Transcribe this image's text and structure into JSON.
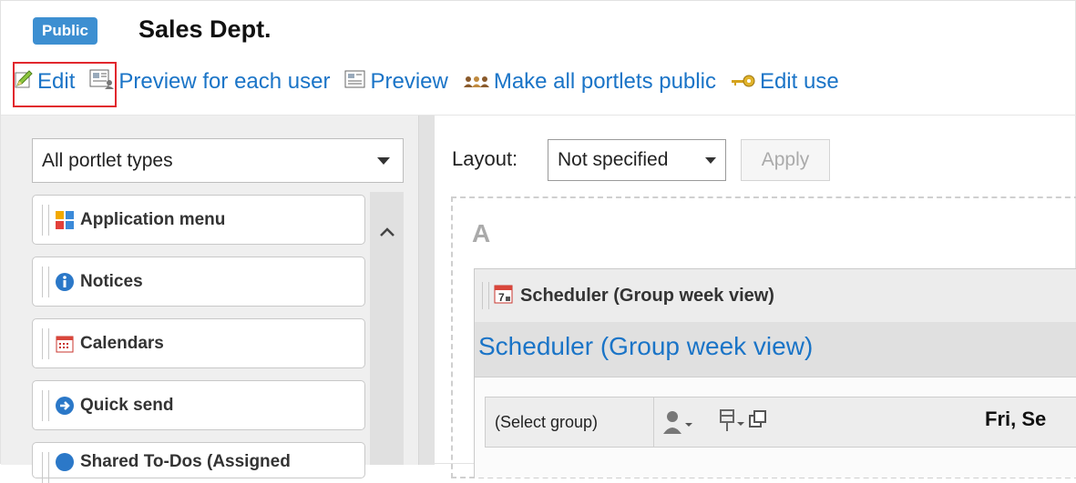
{
  "header": {
    "badge": "Public",
    "title": "Sales Dept."
  },
  "toolbar": {
    "edit": "Edit",
    "preview_each": "Preview for each user",
    "preview": "Preview",
    "make_public": "Make all portlets public",
    "edit_users": "Edit use"
  },
  "left_panel": {
    "portlet_type_select": "All portlet types",
    "portlets": [
      {
        "label": "Application menu",
        "icon": "application-menu-icon"
      },
      {
        "label": "Notices",
        "icon": "info-icon"
      },
      {
        "label": "Calendars",
        "icon": "calendar-icon"
      },
      {
        "label": "Quick send",
        "icon": "arrow-circle-icon"
      },
      {
        "label": "Shared To-Dos (Assigned",
        "icon": "shared-todo-icon"
      }
    ]
  },
  "layout_bar": {
    "label": "Layout:",
    "value": "Not specified",
    "apply": "Apply"
  },
  "dropzone": {
    "label": "A",
    "portlet_header": "Scheduler (Group week view)",
    "portlet_title_link": "Scheduler (Group week view)",
    "group_select": "(Select group)",
    "date": "Fri, Se"
  },
  "colors": {
    "accent": "#1a74c7",
    "badge": "#3d8fd1",
    "highlight": "#e1272d"
  }
}
